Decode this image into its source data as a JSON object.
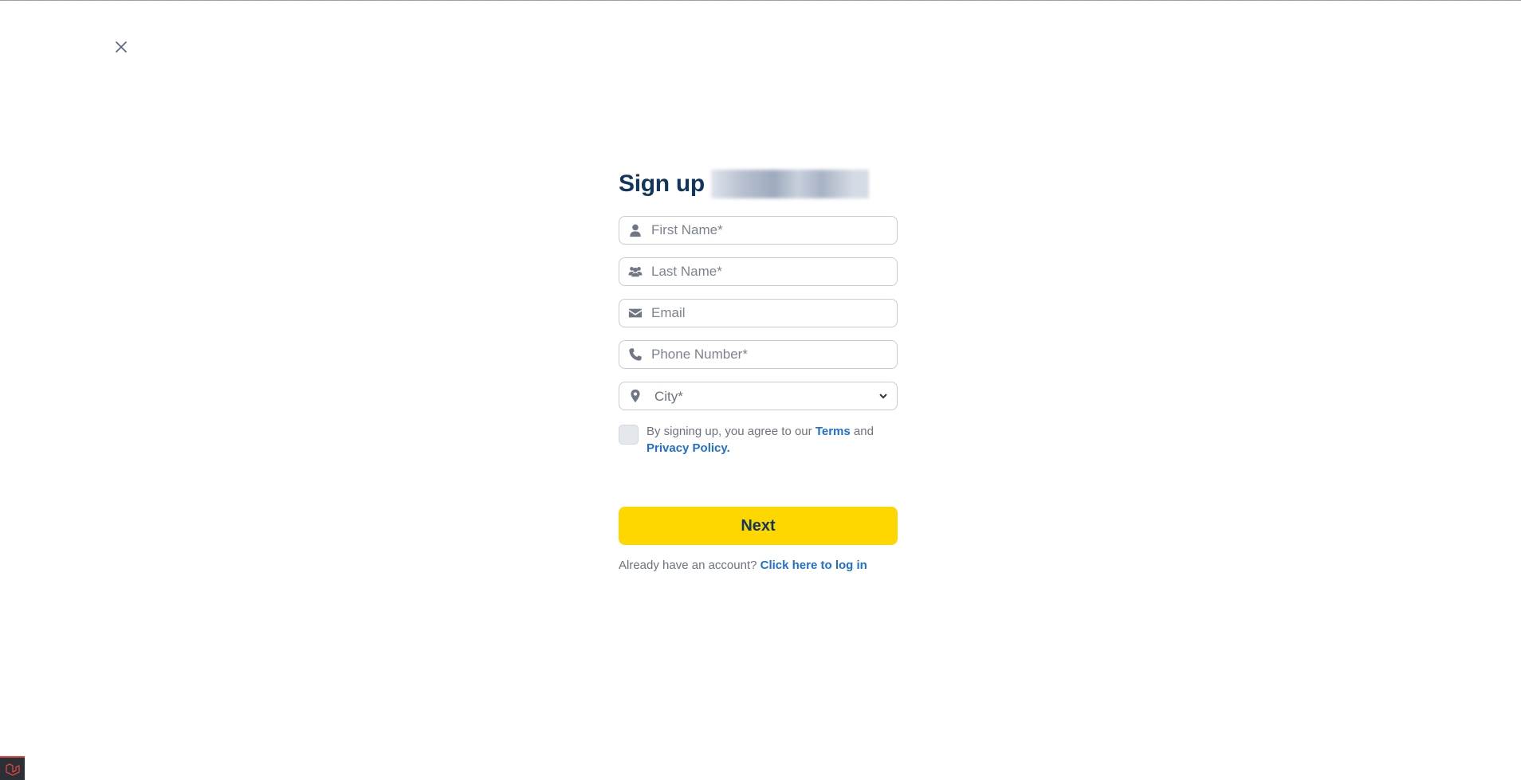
{
  "header": {
    "close_icon": "close-icon"
  },
  "form": {
    "title": "Sign up",
    "fields": {
      "first_name": {
        "placeholder": "First Name*",
        "icon": "user-icon"
      },
      "last_name": {
        "placeholder": "Last Name*",
        "icon": "users-icon"
      },
      "email": {
        "placeholder": "Email",
        "icon": "envelope-icon"
      },
      "phone": {
        "placeholder": "Phone Number*",
        "icon": "phone-icon"
      },
      "city": {
        "selected": "City*",
        "icon": "map-pin-icon"
      }
    },
    "agreement": {
      "prefix": "By signing up, you agree to our",
      "terms_link": "Terms",
      "conjunction": "and",
      "privacy_link": "Privacy Policy."
    },
    "next_label": "Next",
    "login": {
      "prompt": "Already have an account?",
      "link": "Click here to log in"
    }
  },
  "colors": {
    "title": "#12355b",
    "accent_button": "#ffd700",
    "link": "#1f6fd0",
    "muted_text": "#6c737f",
    "border": "#c6ccd3"
  },
  "footer": {
    "badge_icon": "laravel-logo-icon"
  }
}
